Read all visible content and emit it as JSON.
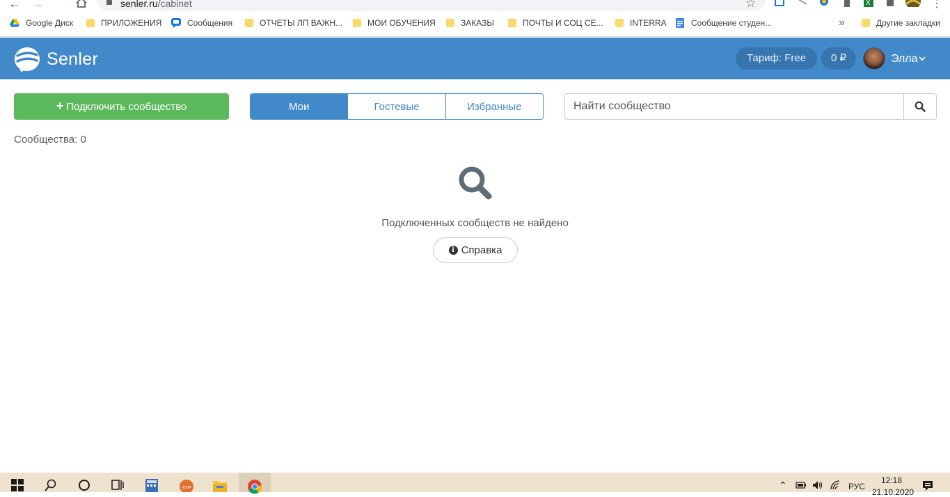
{
  "browser": {
    "url_host": "senler.ru",
    "url_path": "/cabinet"
  },
  "bookmarks": [
    {
      "label": "Google Диск",
      "icon": "google-drive-icon"
    },
    {
      "label": "ПРИЛОЖЕНИЯ",
      "icon": "folder-icon"
    },
    {
      "label": "Сообщения",
      "icon": "chat-icon"
    },
    {
      "label": "ОТЧЕТЫ ЛП ВАЖН...",
      "icon": "folder-icon"
    },
    {
      "label": "МОИ ОБУЧЕНИЯ",
      "icon": "folder-icon"
    },
    {
      "label": "ЗАКАЗЫ",
      "icon": "folder-icon"
    },
    {
      "label": "ПОЧТЫ И СОЦ СЕ...",
      "icon": "folder-icon"
    },
    {
      "label": "INTERRA",
      "icon": "folder-icon"
    },
    {
      "label": "Сообщение студен...",
      "icon": "google-docs-icon"
    },
    {
      "label": "Другие закладки",
      "icon": "folder-icon"
    }
  ],
  "bookmarks_more": "»",
  "header": {
    "logo_text": "Senler",
    "tariff_label": "Тариф: Free",
    "balance_label": "0 ₽",
    "user_name": "Элла"
  },
  "toolbar": {
    "connect_label": "Подключить сообщество",
    "search_placeholder": "Найти сообщество"
  },
  "tabs": {
    "items": [
      "Мои",
      "Гостевые",
      "Избранные"
    ],
    "active_index": 0
  },
  "communities_count_label": "Сообщества: 0",
  "empty_state": {
    "message": "Подключенных сообществ не найдено",
    "help_label": "Справка"
  },
  "taskbar": {
    "lang": "РУС",
    "time": "12:18",
    "date": "21.10.2020"
  },
  "colors": {
    "header_bg": "#4289c9",
    "connect_btn": "#5cb85c",
    "tab_active": "#4289c9"
  }
}
